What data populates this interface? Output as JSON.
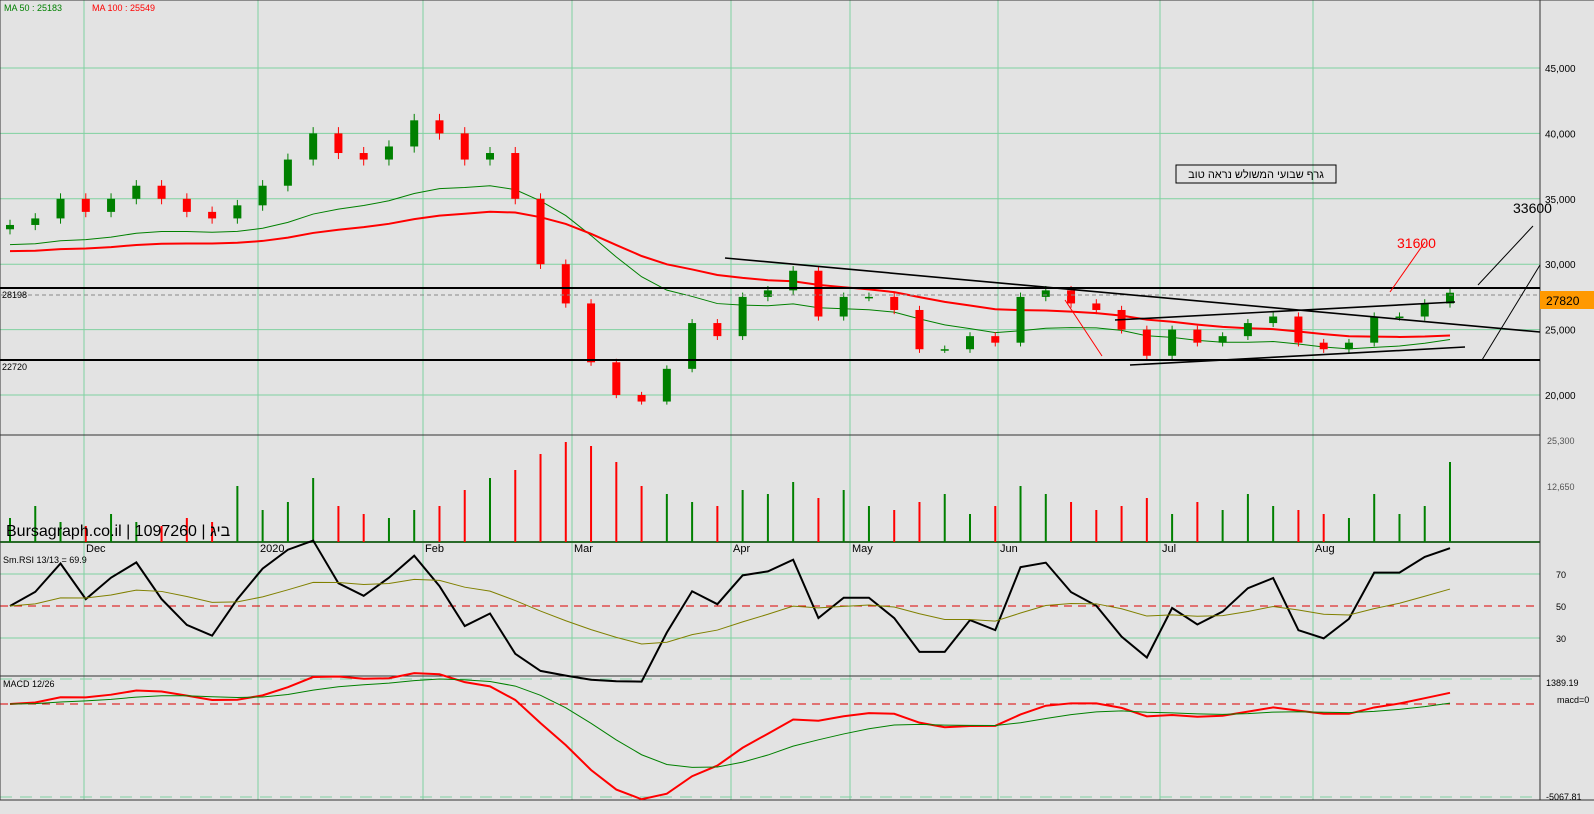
{
  "header": {
    "ma50": "MA 50 : 25183",
    "ma100": "MA 100 : 25549"
  },
  "watermark": "Bursagraph.co.il | 1097260 | ביג",
  "annotation": "גרף שבועי המשולש נראה טוב",
  "levels": {
    "upper": "28198",
    "lower": "22720",
    "target1": "31600",
    "target2": "33600",
    "last": "27820"
  },
  "rsi_label": "Sm.RSI 13/13 = 69.9",
  "macd_label": "MACD 12/26",
  "macd_axis": {
    "top": "1389.19",
    "zero": "macd=0",
    "bottom": "-5067.81"
  },
  "volume_axis": [
    "25,300",
    "12,650"
  ],
  "rsi_axis": [
    "70",
    "50",
    "30"
  ],
  "colors": {
    "up": "#008000",
    "down": "#ff0000",
    "ma50": "#008000",
    "ma100": "#ff0000",
    "last_bg": "#ff9900"
  },
  "chart_data": {
    "type": "candlestick",
    "price_axis": [
      "45,000",
      "40,000",
      "35,000",
      "30,000",
      "25,000",
      "20,000"
    ],
    "price_ticks": [
      45000,
      40000,
      35000,
      30000,
      25000,
      20000
    ],
    "months": [
      "Dec",
      "2020",
      "Feb",
      "Mar",
      "Apr",
      "May",
      "Jun",
      "Jul",
      "Aug"
    ],
    "closes": [
      33000,
      33500,
      35000,
      34000,
      35000,
      36000,
      35000,
      34000,
      33500,
      34500,
      36000,
      38000,
      40000,
      38500,
      38000,
      39000,
      41000,
      40000,
      38000,
      38500,
      35000,
      30000,
      27000,
      22500,
      20000,
      19500,
      22000,
      25500,
      24500,
      27500,
      28000,
      29500,
      26000,
      27500,
      27500,
      26500,
      23500,
      23500,
      24500,
      24000,
      27500,
      28000,
      27000,
      26500,
      25000,
      23000,
      25000,
      24000,
      24500,
      25500,
      26000,
      24000,
      23500,
      24000,
      26000,
      26000,
      27000,
      27820
    ],
    "volumes": [
      6,
      9,
      5,
      4,
      7,
      5,
      4,
      6,
      5,
      14,
      8,
      10,
      16,
      9,
      7,
      6,
      8,
      9,
      13,
      16,
      18,
      22,
      25,
      24,
      20,
      14,
      12,
      10,
      9,
      13,
      12,
      15,
      11,
      13,
      9,
      8,
      10,
      12,
      7,
      9,
      14,
      12,
      10,
      8,
      9,
      11,
      7,
      10,
      8,
      12,
      9,
      8,
      7,
      6,
      12,
      7,
      9,
      20
    ]
  }
}
